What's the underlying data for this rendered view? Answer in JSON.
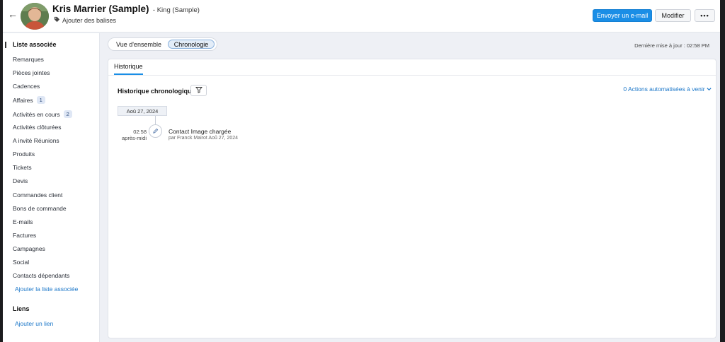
{
  "header": {
    "name": "Kris Marrier (Sample)",
    "subtitle": "- King (Sample)",
    "add_tags": "Ajouter des balises",
    "send_email": "Envoyer un e-mail",
    "edit": "Modifier",
    "more": "•••"
  },
  "sidebar": {
    "related_title": "Liste associée",
    "items": [
      {
        "label": "Remarques"
      },
      {
        "label": "Pièces jointes"
      },
      {
        "label": "Cadences"
      },
      {
        "label": "Affaires",
        "badge": "1"
      },
      {
        "label": "Activités en cours",
        "badge": "2"
      },
      {
        "label": "Activités clôturées"
      },
      {
        "label": "A invité Réunions"
      },
      {
        "label": "Produits"
      },
      {
        "label": "Tickets"
      },
      {
        "label": "Devis"
      },
      {
        "label": "Commandes client"
      },
      {
        "label": "Bons de commande"
      },
      {
        "label": "E-mails"
      },
      {
        "label": "Factures"
      },
      {
        "label": "Campagnes"
      },
      {
        "label": "Social"
      },
      {
        "label": "Contacts dépendants"
      }
    ],
    "add_related": "Ajouter la liste associée",
    "links_title": "Liens",
    "add_link": "Ajouter un lien"
  },
  "main": {
    "segments": [
      "Vue d'ensemble",
      "Chronologie"
    ],
    "last_update": "Dernière mise à jour : 02:58 PM",
    "tab": "Historique",
    "history_title": "Historique chronologique",
    "auto_actions": "0 Actions automatisées à venir",
    "timeline": {
      "date": "Aoû 27, 2024",
      "time": "02:58",
      "period": "après-midi",
      "title": "Contact Image chargée",
      "subtitle": "par Franck Mairot Aoû 27, 2024"
    }
  },
  "colors": {
    "accent": "#1a8ee6",
    "link": "#1a76c8",
    "background": "#eef0f5"
  },
  "icons": {
    "back": "arrow-left-icon",
    "tag": "tag-icon",
    "filter": "filter-icon",
    "edit": "pencil-icon",
    "chevron": "chevron-down-icon"
  }
}
